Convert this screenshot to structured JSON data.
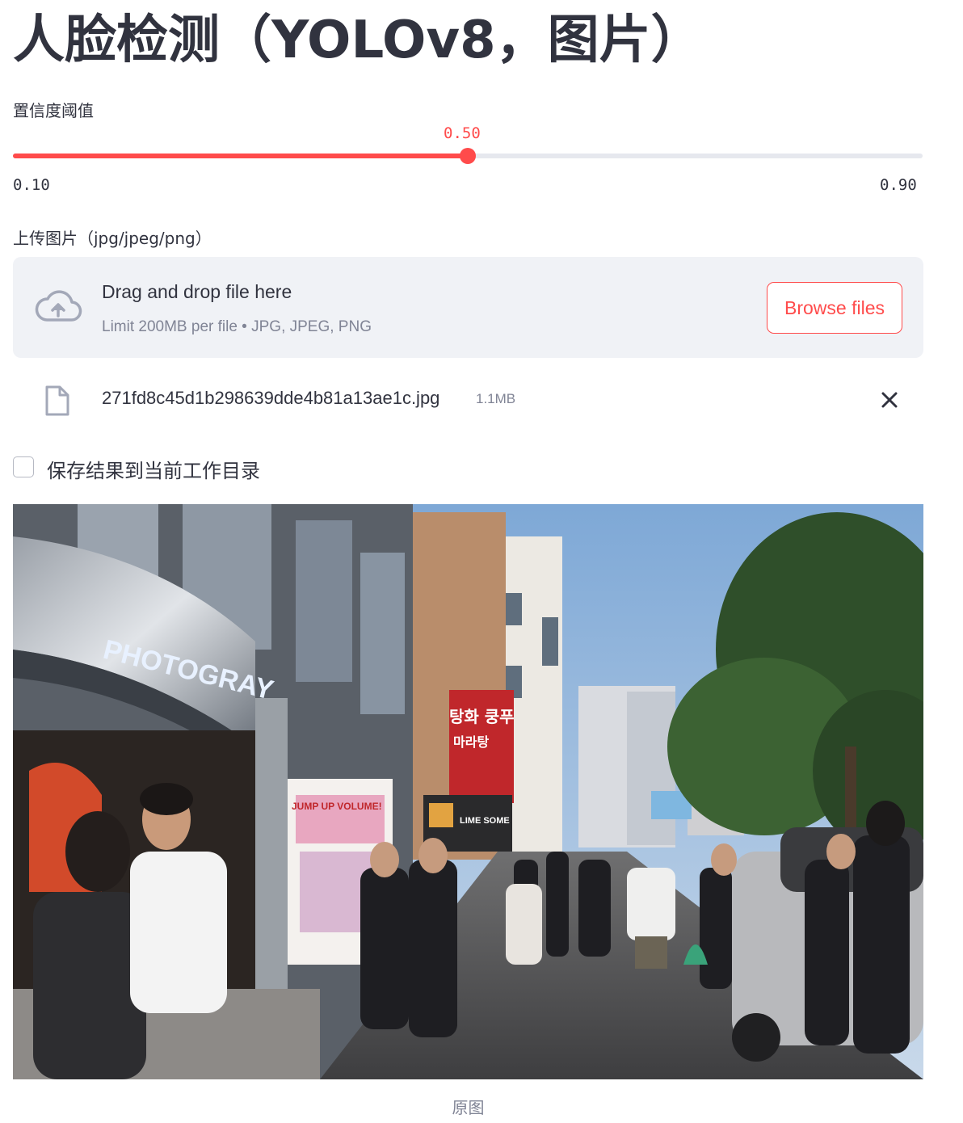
{
  "header": {
    "title": "人脸检测（YOLOv8，图片）"
  },
  "slider": {
    "label": "置信度阈值",
    "value": 0.5,
    "value_text": "0.50",
    "min": 0.1,
    "min_text": "0.10",
    "max": 0.9,
    "max_text": "0.90",
    "accent_color": "#ff4b4b"
  },
  "uploader": {
    "label": "上传图片（jpg/jpeg/png）",
    "drop_title": "Drag and drop file here",
    "limit_text": "Limit 200MB per file • JPG, JPEG, PNG",
    "browse_label": "Browse files",
    "icon": "cloud-upload-icon"
  },
  "uploaded_file": {
    "name": "271fd8c45d1b298639dde4b81a13ae1c.jpg",
    "size": "1.1MB",
    "icon": "file-icon",
    "remove_icon": "close-icon"
  },
  "save_option": {
    "label": "保存结果到当前工作目录",
    "checked": false
  },
  "image": {
    "caption": "原图",
    "signs": {
      "store": "PHOTOGRAY",
      "korean_1": "탕화 쿵푸",
      "korean_2": "마라탕",
      "shop_small": "LIME SOME",
      "poster": "JUMP UP VOLUME!"
    }
  }
}
